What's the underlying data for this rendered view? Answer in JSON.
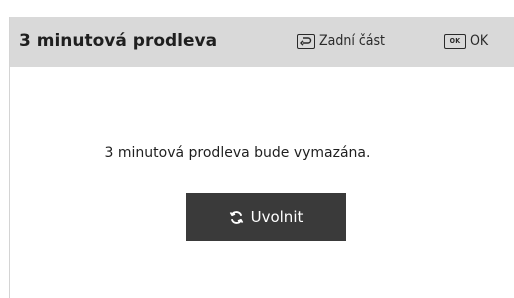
{
  "dialog": {
    "title": "3 minutová prodleva",
    "hints": {
      "back": {
        "icon": "return-key-icon",
        "label": "Zadní část"
      },
      "ok": {
        "icon": "ok-key-icon",
        "key_text": "OK",
        "label": "OK"
      }
    },
    "message": "3 minutová prodleva bude vymazána.",
    "release_button": {
      "icon": "refresh-icon",
      "label": "Uvolnit"
    }
  },
  "colors": {
    "header_bg": "#d9d9d9",
    "button_bg": "#3a3a3a",
    "text": "#1f1f1f"
  }
}
